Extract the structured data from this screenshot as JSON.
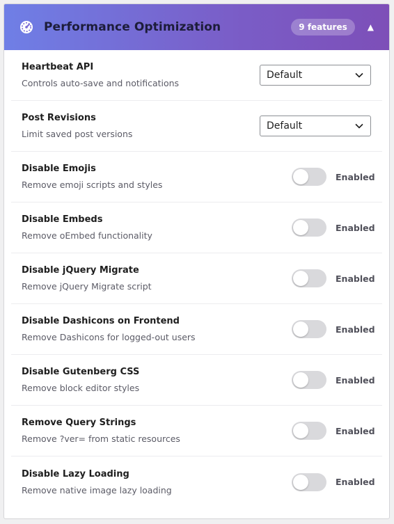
{
  "header": {
    "title": "Performance Optimization",
    "badge": "9 features",
    "collapse_glyph": "▲",
    "icon": "speedometer-icon",
    "gradient_start": "#6f7fe6",
    "gradient_end": "#7d4fb8"
  },
  "rows": [
    {
      "title": "Heartbeat API",
      "desc": "Controls auto-save and notifications",
      "control": "select",
      "value": "Default"
    },
    {
      "title": "Post Revisions",
      "desc": "Limit saved post versions",
      "control": "select",
      "value": "Default"
    },
    {
      "title": "Disable Emojis",
      "desc": "Remove emoji scripts and styles",
      "control": "toggle",
      "value": "Enabled"
    },
    {
      "title": "Disable Embeds",
      "desc": "Remove oEmbed functionality",
      "control": "toggle",
      "value": "Enabled"
    },
    {
      "title": "Disable jQuery Migrate",
      "desc": "Remove jQuery Migrate script",
      "control": "toggle",
      "value": "Enabled"
    },
    {
      "title": "Disable Dashicons on Frontend",
      "desc": "Remove Dashicons for logged-out users",
      "control": "toggle",
      "value": "Enabled"
    },
    {
      "title": "Disable Gutenberg CSS",
      "desc": "Remove block editor styles",
      "control": "toggle",
      "value": "Enabled"
    },
    {
      "title": "Remove Query Strings",
      "desc": "Remove ?ver= from static resources",
      "control": "toggle",
      "value": "Enabled"
    },
    {
      "title": "Disable Lazy Loading",
      "desc": "Remove native image lazy loading",
      "control": "toggle",
      "value": "Enabled"
    }
  ]
}
